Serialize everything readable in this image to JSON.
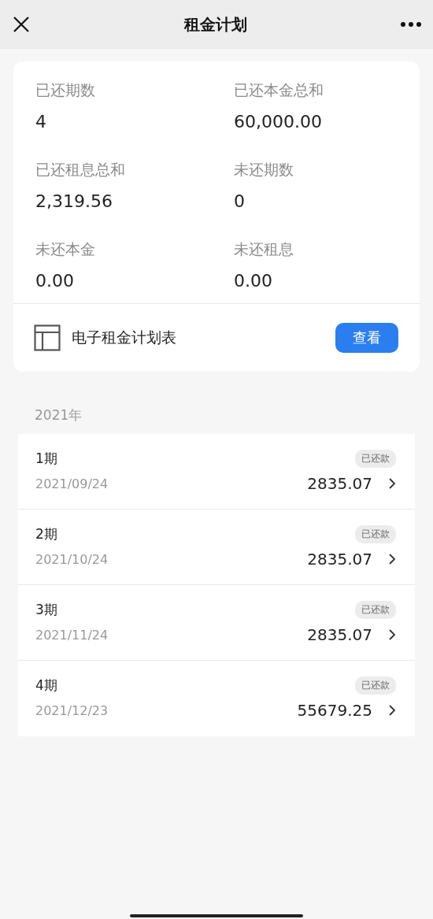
{
  "header": {
    "title": "租金计划"
  },
  "summary": [
    {
      "label": "已还期数",
      "value": "4"
    },
    {
      "label": "已还本金总和",
      "value": "60,000.00"
    },
    {
      "label": "已还租息总和",
      "value": "2,319.56"
    },
    {
      "label": "未还期数",
      "value": "0"
    },
    {
      "label": "未还本金",
      "value": "0.00"
    },
    {
      "label": "未还租息",
      "value": "0.00"
    }
  ],
  "document": {
    "label": "电子租金计划表",
    "button": "查看"
  },
  "year_label": "2021年",
  "installments": [
    {
      "period": "1期",
      "date": "2021/09/24",
      "status": "已还款",
      "amount": "2835.07"
    },
    {
      "period": "2期",
      "date": "2021/10/24",
      "status": "已还款",
      "amount": "2835.07"
    },
    {
      "period": "3期",
      "date": "2021/11/24",
      "status": "已还款",
      "amount": "2835.07"
    },
    {
      "period": "4期",
      "date": "2021/12/23",
      "status": "已还款",
      "amount": "55679.25"
    }
  ]
}
